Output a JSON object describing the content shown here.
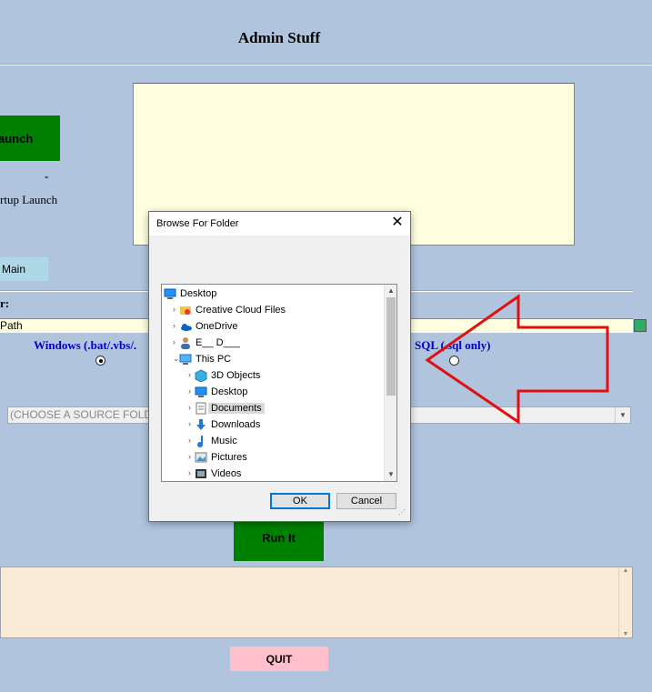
{
  "page": {
    "title": "Admin Stuff",
    "launch_label": "aunch",
    "dash": "-",
    "startup_launch_label": "rtup Launch",
    "main_label": "Main",
    "folder_label": "r:",
    "path_text": "Path",
    "windows_label": "Windows (.bat/.vbs/.",
    "sql_label": "SQL (.sql only)",
    "source_placeholder_left": "(CHOOSE A SOURCE FOLD",
    "run_label": "Run It",
    "quit_label": "QUIT"
  },
  "radios": {
    "windows_selected": true,
    "sql_selected": false
  },
  "dialog": {
    "title": "Browse For Folder",
    "ok_label": "OK",
    "cancel_label": "Cancel",
    "tree": [
      {
        "label": "Desktop",
        "level": 0,
        "chevron": "",
        "icon": "desktop-icon"
      },
      {
        "label": "Creative Cloud Files",
        "level": 1,
        "chevron": ">",
        "icon": "creative-cloud-icon"
      },
      {
        "label": "OneDrive",
        "level": 1,
        "chevron": ">",
        "icon": "onedrive-icon"
      },
      {
        "label": "E__ D___",
        "level": 1,
        "chevron": ">",
        "icon": "user-icon"
      },
      {
        "label": "This PC",
        "level": 1,
        "chevron": "v",
        "icon": "pc-icon"
      },
      {
        "label": "3D Objects",
        "level": 2,
        "chevron": ">",
        "icon": "3d-objects-icon"
      },
      {
        "label": "Desktop",
        "level": 2,
        "chevron": ">",
        "icon": "desktop-icon"
      },
      {
        "label": "Documents",
        "level": 2,
        "chevron": ">",
        "icon": "documents-icon",
        "selected": true
      },
      {
        "label": "Downloads",
        "level": 2,
        "chevron": ">",
        "icon": "downloads-icon"
      },
      {
        "label": "Music",
        "level": 2,
        "chevron": ">",
        "icon": "music-icon"
      },
      {
        "label": "Pictures",
        "level": 2,
        "chevron": ">",
        "icon": "pictures-icon"
      },
      {
        "label": "Videos",
        "level": 2,
        "chevron": ">",
        "icon": "videos-icon"
      }
    ]
  },
  "annotation": {
    "arrow_color": "#e01010"
  },
  "colors": {
    "background": "#b0c4de",
    "launch": "#008000",
    "main": "#add8e6",
    "quit": "#ffc0cb",
    "output": "#faebd7",
    "note": "#ffffe0",
    "link": "#0000cc"
  }
}
